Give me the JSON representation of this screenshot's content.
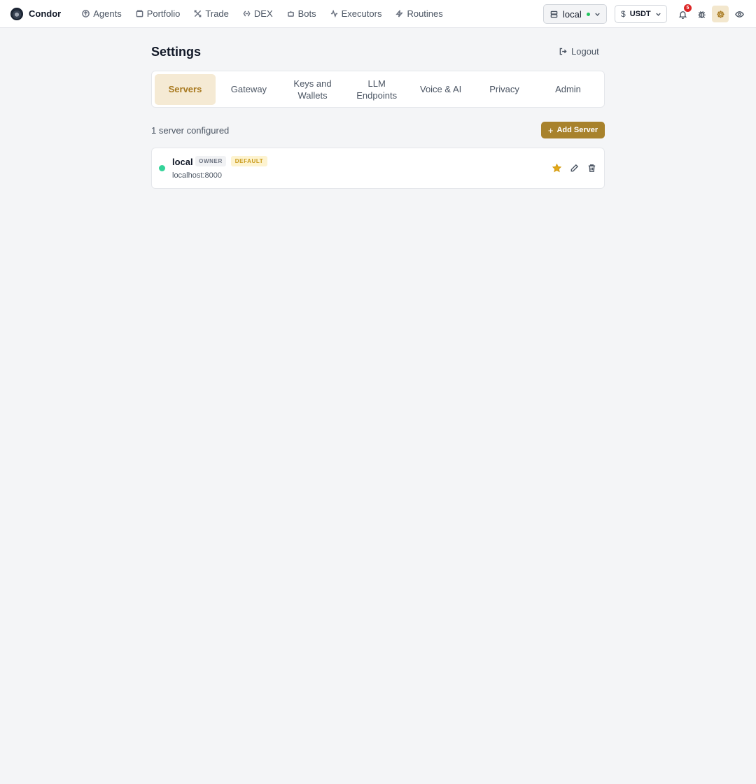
{
  "app": {
    "name": "Condor",
    "logo_icon": "condor-logo"
  },
  "nav": {
    "items": [
      {
        "label": "Agents",
        "icon": "agents-icon"
      },
      {
        "label": "Portfolio",
        "icon": "portfolio-icon"
      },
      {
        "label": "Trade",
        "icon": "trade-icon"
      },
      {
        "label": "DEX",
        "icon": "dex-icon"
      },
      {
        "label": "Bots",
        "icon": "bots-icon"
      },
      {
        "label": "Executors",
        "icon": "executors-icon"
      },
      {
        "label": "Routines",
        "icon": "routines-icon"
      }
    ]
  },
  "toolbar": {
    "server_select": {
      "value": "local",
      "status_color": "#22c55e"
    },
    "currency_select": {
      "symbol": "$",
      "value": "USDT"
    },
    "notifications": {
      "count": "5"
    },
    "icons": [
      "bell-icon",
      "bug-icon",
      "settings-icon",
      "eye-icon"
    ],
    "active_icon": "settings-icon",
    "accent_color": "#a8822c"
  },
  "settings": {
    "title": "Settings",
    "logout_label": "Logout",
    "tabs": [
      {
        "label": "Servers",
        "active": true
      },
      {
        "label": "Gateway",
        "active": false
      },
      {
        "label": "Keys and Wallets",
        "active": false
      },
      {
        "label": "LLM Endpoints",
        "active": false
      },
      {
        "label": "Voice & AI",
        "active": false
      },
      {
        "label": "Privacy",
        "active": false
      },
      {
        "label": "Admin",
        "active": false
      }
    ],
    "servers_count_text": "1 server configured",
    "add_server_label": "Add Server",
    "servers": [
      {
        "name": "local",
        "badges": [
          "OWNER",
          "DEFAULT"
        ],
        "host": "localhost:8000",
        "status_color": "#34d399",
        "actions": [
          "star-icon",
          "edit-icon",
          "trash-icon"
        ]
      }
    ]
  }
}
